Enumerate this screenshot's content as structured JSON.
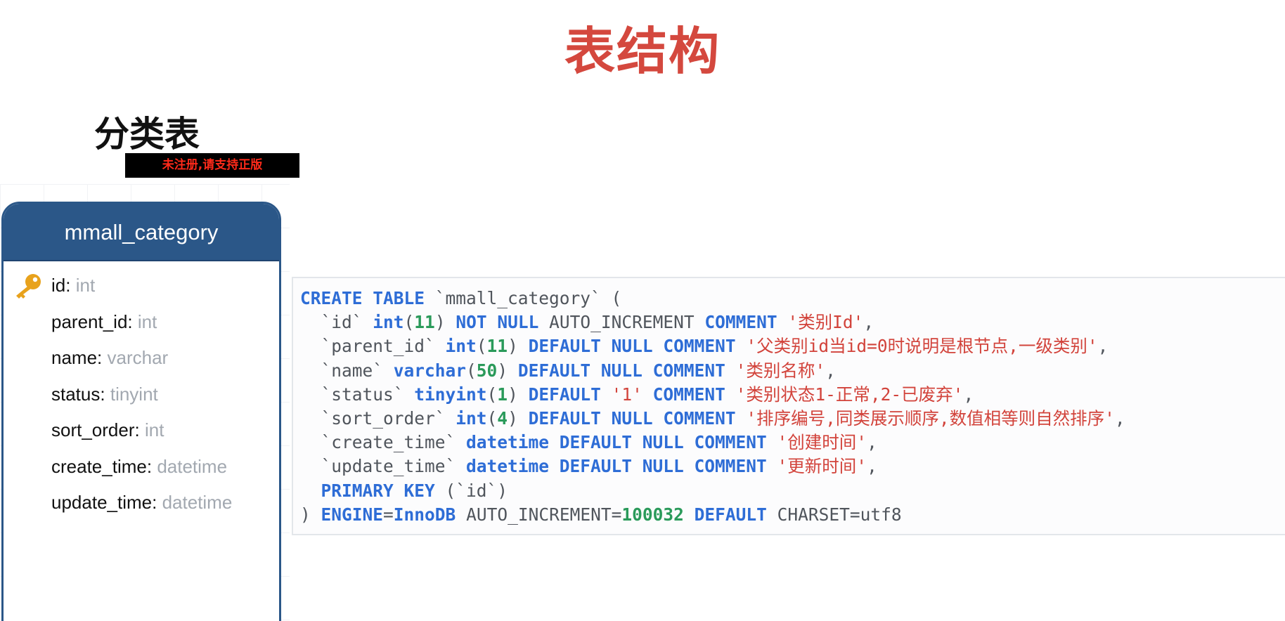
{
  "slide": {
    "title": "表结构",
    "section_heading": "分类表",
    "watermark": "未注册,请支持正版"
  },
  "table_card": {
    "table_name": "mmall_category",
    "fields": [
      {
        "name": "id",
        "type": "int",
        "primary_key": true
      },
      {
        "name": "parent_id",
        "type": "int"
      },
      {
        "name": "name",
        "type": "varchar"
      },
      {
        "name": "status",
        "type": "tinyint"
      },
      {
        "name": "sort_order",
        "type": "int"
      },
      {
        "name": "create_time",
        "type": "datetime"
      },
      {
        "name": "update_time",
        "type": "datetime"
      }
    ],
    "separator": ":",
    "colors": {
      "header_bg": "#2b5788",
      "type_text": "#a2a8b0",
      "key_icon": "#e8a21c"
    }
  },
  "code": {
    "colors": {
      "keyword": "#2e6dd6",
      "number": "#2a9a5a",
      "string": "#d2433b",
      "plain": "#50555c"
    },
    "lines": [
      [
        [
          "kw",
          "CREATE TABLE"
        ],
        [
          "plain",
          " `mmall_category` ("
        ]
      ],
      [
        [
          "plain",
          "  `id` "
        ],
        [
          "kw",
          "int"
        ],
        [
          "plain",
          "("
        ],
        [
          "num",
          "11"
        ],
        [
          "plain",
          ") "
        ],
        [
          "kw",
          "NOT NULL"
        ],
        [
          "plain",
          " AUTO_INCREMENT "
        ],
        [
          "kw",
          "COMMENT"
        ],
        [
          "plain",
          " "
        ],
        [
          "str",
          "'类别Id'"
        ],
        [
          "plain",
          ","
        ]
      ],
      [
        [
          "plain",
          "  `parent_id` "
        ],
        [
          "kw",
          "int"
        ],
        [
          "plain",
          "("
        ],
        [
          "num",
          "11"
        ],
        [
          "plain",
          ") "
        ],
        [
          "kw",
          "DEFAULT NULL COMMENT"
        ],
        [
          "plain",
          " "
        ],
        [
          "str",
          "'父类别id当id=0时说明是根节点,一级类别'"
        ],
        [
          "plain",
          ","
        ]
      ],
      [
        [
          "plain",
          "  `name` "
        ],
        [
          "kw",
          "varchar"
        ],
        [
          "plain",
          "("
        ],
        [
          "num",
          "50"
        ],
        [
          "plain",
          ") "
        ],
        [
          "kw",
          "DEFAULT NULL COMMENT"
        ],
        [
          "plain",
          " "
        ],
        [
          "str",
          "'类别名称'"
        ],
        [
          "plain",
          ","
        ]
      ],
      [
        [
          "plain",
          "  `status` "
        ],
        [
          "kw",
          "tinyint"
        ],
        [
          "plain",
          "("
        ],
        [
          "num",
          "1"
        ],
        [
          "plain",
          ") "
        ],
        [
          "kw",
          "DEFAULT"
        ],
        [
          "plain",
          " "
        ],
        [
          "str",
          "'1'"
        ],
        [
          "plain",
          " "
        ],
        [
          "kw",
          "COMMENT"
        ],
        [
          "plain",
          " "
        ],
        [
          "str",
          "'类别状态1-正常,2-已废弃'"
        ],
        [
          "plain",
          ","
        ]
      ],
      [
        [
          "plain",
          "  `sort_order` "
        ],
        [
          "kw",
          "int"
        ],
        [
          "plain",
          "("
        ],
        [
          "num",
          "4"
        ],
        [
          "plain",
          ") "
        ],
        [
          "kw",
          "DEFAULT NULL COMMENT"
        ],
        [
          "plain",
          " "
        ],
        [
          "str",
          "'排序编号,同类展示顺序,数值相等则自然排序'"
        ],
        [
          "plain",
          ","
        ]
      ],
      [
        [
          "plain",
          "  `create_time` "
        ],
        [
          "kw",
          "datetime DEFAULT NULL COMMENT"
        ],
        [
          "plain",
          " "
        ],
        [
          "str",
          "'创建时间'"
        ],
        [
          "plain",
          ","
        ]
      ],
      [
        [
          "plain",
          "  `update_time` "
        ],
        [
          "kw",
          "datetime DEFAULT NULL COMMENT"
        ],
        [
          "plain",
          " "
        ],
        [
          "str",
          "'更新时间'"
        ],
        [
          "plain",
          ","
        ]
      ],
      [
        [
          "plain",
          "  "
        ],
        [
          "kw",
          "PRIMARY KEY"
        ],
        [
          "plain",
          " (`id`)"
        ]
      ],
      [
        [
          "plain",
          ") "
        ],
        [
          "kw",
          "ENGINE"
        ],
        [
          "plain",
          "="
        ],
        [
          "kw",
          "InnoDB"
        ],
        [
          "plain",
          " AUTO_INCREMENT="
        ],
        [
          "num",
          "100032"
        ],
        [
          "plain",
          " "
        ],
        [
          "kw",
          "DEFAULT"
        ],
        [
          "plain",
          " CHARSET=utf8"
        ]
      ]
    ]
  }
}
